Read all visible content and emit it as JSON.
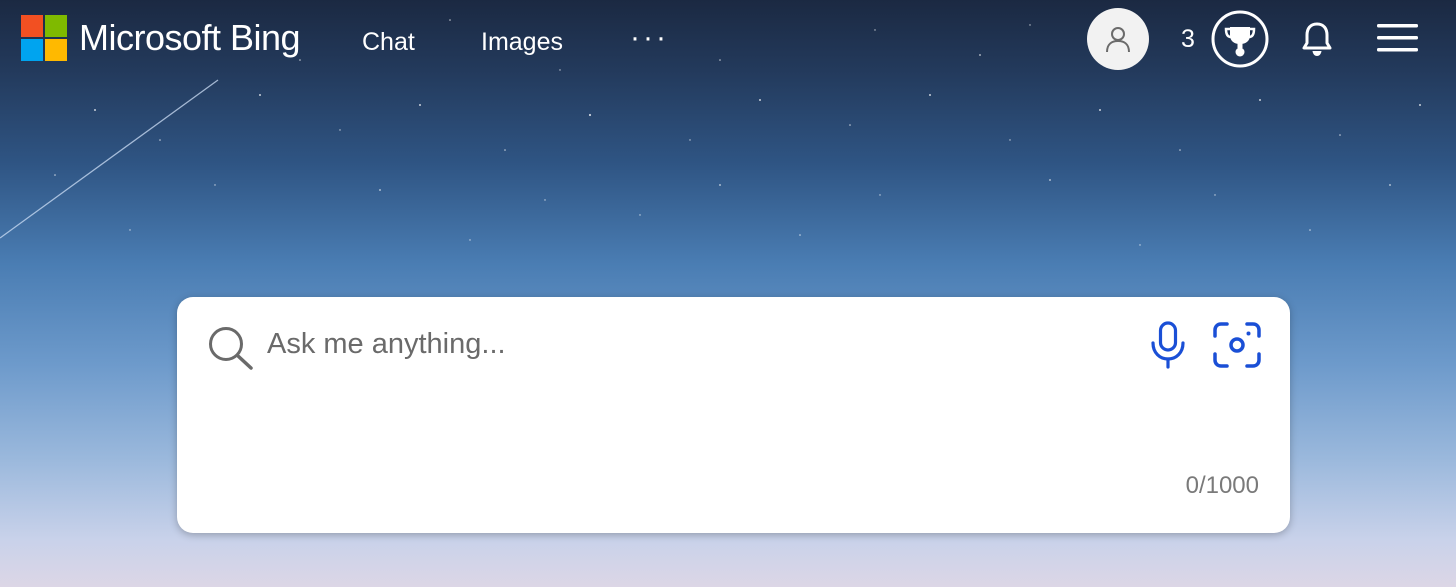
{
  "brand": {
    "name": "Microsoft Bing",
    "logo_colors": [
      "#f25022",
      "#7fba00",
      "#00a4ef",
      "#ffb900"
    ]
  },
  "nav": {
    "items": [
      {
        "label": "Chat"
      },
      {
        "label": "Images"
      }
    ],
    "more_label": "···"
  },
  "header_right": {
    "avatar_icon": "person-icon",
    "points": "3",
    "rewards_icon": "rewards-trophy-icon",
    "notifications_icon": "bell-icon",
    "menu_icon": "hamburger-menu-icon"
  },
  "search": {
    "placeholder": "Ask me anything...",
    "value": "",
    "char_count": "0/1000",
    "icons": {
      "search": "search-icon",
      "microphone": "microphone-icon",
      "visual_search": "visual-search-camera-icon"
    },
    "accent_color": "#1a4fd6"
  }
}
